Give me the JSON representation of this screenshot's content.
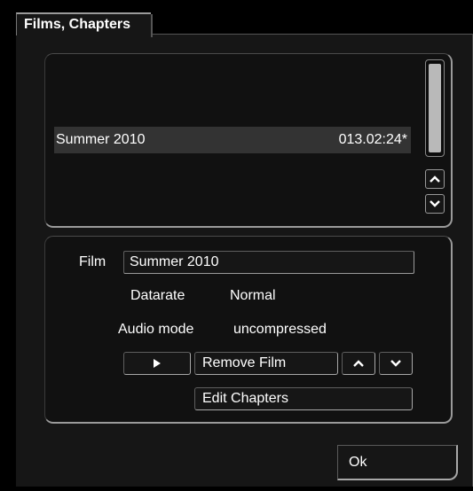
{
  "window": {
    "title": "Films, Chapters"
  },
  "film_list": {
    "items": [
      {
        "name": "Summer 2010",
        "duration": "013.02:24*"
      }
    ]
  },
  "form": {
    "film_label": "Film",
    "film_value": "Summer 2010",
    "datarate_label": "Datarate",
    "datarate_value": "Normal",
    "audio_mode_label": "Audio mode",
    "audio_mode_value": "uncompressed",
    "remove_film_label": "Remove Film",
    "edit_chapters_label": "Edit Chapters"
  },
  "footer": {
    "ok_label": "Ok"
  },
  "icons": {
    "play": "play-icon",
    "up": "chevron-up-icon",
    "down": "chevron-down-icon"
  }
}
